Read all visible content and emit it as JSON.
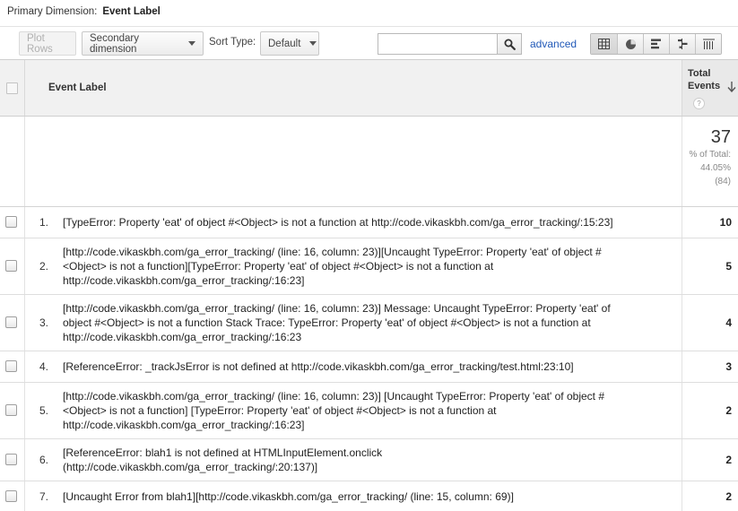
{
  "primary_dimension": {
    "label": "Primary Dimension:",
    "value": "Event Label"
  },
  "toolbar": {
    "plot_rows": "Plot Rows",
    "secondary_dimension": "Secondary dimension",
    "sort_type_label": "Sort Type:",
    "sort_type_value": "Default",
    "search_value": "",
    "advanced": "advanced"
  },
  "table": {
    "dimension_header": "Event Label",
    "metric_header": "Total Events",
    "help_glyph": "?",
    "summary": {
      "total": "37",
      "pct_label": "% of Total:",
      "pct_value": "44.05%",
      "overall": "(84)"
    },
    "rows": [
      {
        "index": "1.",
        "lines": [
          "[TypeError: Property 'eat' of object #<Object> is not a function at http://code.vikaskbh.com/ga_error_tracking/:15:23]"
        ],
        "value": "10"
      },
      {
        "index": "2.",
        "lines": [
          "[http://code.vikaskbh.com/ga_error_tracking/ (line: 16, column: 23)][Uncaught TypeError: Property 'eat' of object #",
          "<Object> is not a function][TypeError: Property 'eat' of object #<Object> is not a function at",
          "http://code.vikaskbh.com/ga_error_tracking/:16:23]"
        ],
        "value": "5"
      },
      {
        "index": "3.",
        "lines": [
          "[http://code.vikaskbh.com/ga_error_tracking/ (line: 16, column: 23)] Message: Uncaught TypeError: Property 'eat' of",
          "object #<Object> is not a function Stack Trace: TypeError: Property 'eat' of object #<Object> is not a function at",
          "http://code.vikaskbh.com/ga_error_tracking/:16:23"
        ],
        "value": "4"
      },
      {
        "index": "4.",
        "lines": [
          "[ReferenceError: _trackJsError is not defined at http://code.vikaskbh.com/ga_error_tracking/test.html:23:10]"
        ],
        "value": "3"
      },
      {
        "index": "5.",
        "lines": [
          "[http://code.vikaskbh.com/ga_error_tracking/ (line: 16, column: 23)] [Uncaught TypeError: Property 'eat' of object #",
          "<Object> is not a function] [TypeError: Property 'eat' of object #<Object> is not a function at",
          "http://code.vikaskbh.com/ga_error_tracking/:16:23]"
        ],
        "value": "2"
      },
      {
        "index": "6.",
        "lines": [
          "[ReferenceError: blah1 is not defined at HTMLInputElement.onclick",
          "(http://code.vikaskbh.com/ga_error_tracking/:20:137)]"
        ],
        "value": "2"
      },
      {
        "index": "7.",
        "lines": [
          "[Uncaught Error from blah1][http://code.vikaskbh.com/ga_error_tracking/ (line: 15, column: 69)]"
        ],
        "value": "2"
      }
    ]
  },
  "icons": {
    "search": "magnifier-icon",
    "views": [
      "table-view-icon",
      "pie-view-icon",
      "bar-view-icon",
      "comparison-view-icon",
      "pivot-view-icon"
    ],
    "sort": "sort-descending-arrow-icon"
  },
  "colors": {
    "link": "#2159b8",
    "header_bg": "#f1f1f1",
    "metric_header_bg": "#e9e9e9"
  }
}
